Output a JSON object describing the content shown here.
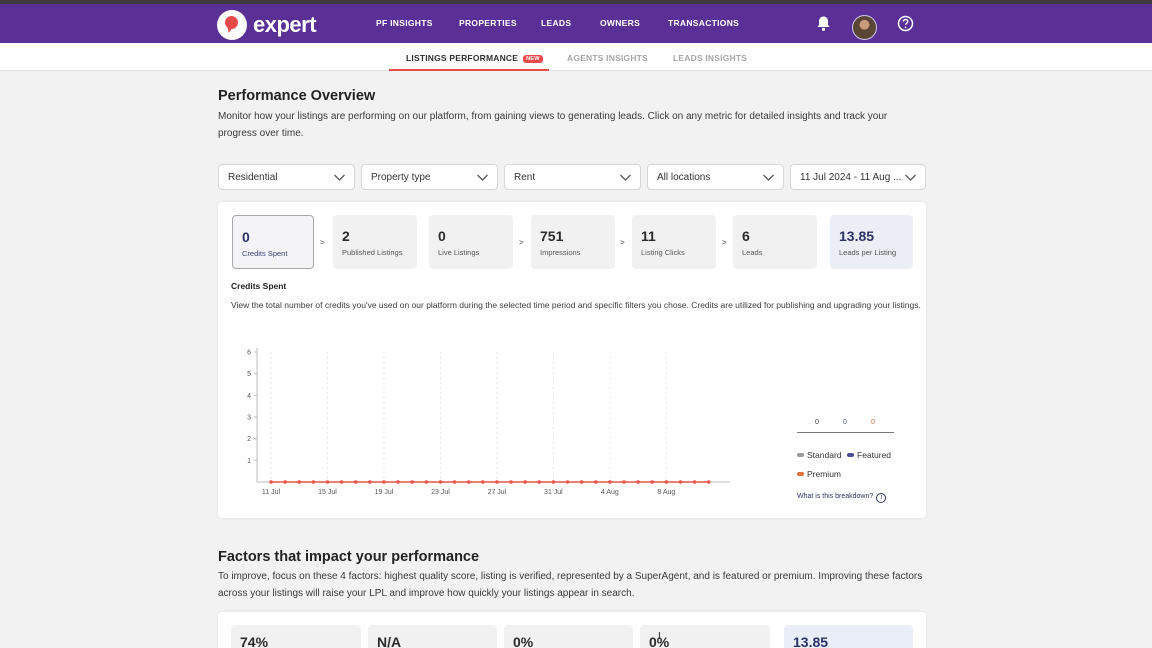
{
  "header": {
    "logo_text": "expert",
    "nav": [
      "PF INSIGHTS",
      "PROPERTIES",
      "LEADS",
      "OWNERS",
      "TRANSACTIONS"
    ],
    "icons": [
      "bell-icon",
      "avatar",
      "help-icon"
    ]
  },
  "subnav": {
    "tabs": [
      "LISTINGS PERFORMANCE",
      "AGENTS INSIGHTS",
      "LEADS INSIGHTS"
    ],
    "active_tab": "LISTINGS PERFORMANCE",
    "new_badge": "NEW"
  },
  "overview": {
    "title": "Performance Overview",
    "description": "Monitor how your listings are performing on our platform, from gaining views to generating leads. Click on any metric for detailed insights and track your progress over time."
  },
  "filters": [
    "Residential",
    "Property type",
    "Rent",
    "All locations",
    "11 Jul 2024 - 11 Aug ..."
  ],
  "metrics": [
    {
      "value": "0",
      "label": "Credits Spent"
    },
    {
      "value": "2",
      "label": "Published Listings"
    },
    {
      "value": "0",
      "label": "Live Listings"
    },
    {
      "value": "751",
      "label": "Impressions"
    },
    {
      "value": "11",
      "label": "Listing Clicks"
    },
    {
      "value": "6",
      "label": "Leads"
    },
    {
      "value": "13.85",
      "label": "Leads per Listing"
    }
  ],
  "metric_arrow": ">",
  "credits": {
    "title": "Credits Spent",
    "description": "View the total number of credits you've used on our platform during the selected time period and specific filters you chose. Credits are utilized for publishing and upgrading your listings."
  },
  "chart_data": {
    "type": "line",
    "x_tick_labels": [
      "11 Jul",
      "15 Jul",
      "19 Jul",
      "23 Jul",
      "27 Jul",
      "31 Jul",
      "4 Aug",
      "8 Aug"
    ],
    "y_tick_labels": [
      "1",
      "2",
      "3",
      "4",
      "5",
      "6"
    ],
    "ylim": [
      0,
      6
    ],
    "grid": "vertical dashed",
    "series": [
      {
        "color": "#e8554a",
        "x": [
          "11 Jul",
          "12 Jul",
          "13 Jul",
          "14 Jul",
          "15 Jul",
          "16 Jul",
          "17 Jul",
          "18 Jul",
          "19 Jul",
          "20 Jul",
          "21 Jul",
          "22 Jul",
          "23 Jul",
          "24 Jul",
          "25 Jul",
          "26 Jul",
          "27 Jul",
          "28 Jul",
          "29 Jul",
          "30 Jul",
          "31 Jul",
          "1 Aug",
          "2 Aug",
          "3 Aug",
          "4 Aug",
          "5 Aug",
          "6 Aug",
          "7 Aug",
          "8 Aug",
          "9 Aug",
          "10 Aug",
          "11 Aug"
        ],
        "values": [
          0,
          0,
          0,
          0,
          0,
          0,
          0,
          0,
          0,
          0,
          0,
          0,
          0,
          0,
          0,
          0,
          0,
          0,
          0,
          0,
          0,
          0,
          0,
          0,
          0,
          0,
          0,
          0,
          0,
          0,
          0,
          0
        ]
      }
    ],
    "legend": [
      {
        "name": "Standard",
        "value": "0",
        "color": "#9a9a9a"
      },
      {
        "name": "Featured",
        "value": "0",
        "color": "#4a4f9a"
      },
      {
        "name": "Premium",
        "value": "0",
        "color": "#e0703a"
      }
    ],
    "legend_position": "right"
  },
  "breakdown_link": "What is this breakdown?",
  "factors": {
    "title": "Factors that impact your performance",
    "description": "To improve, focus on these 4 factors: highest quality score, listing is verified, represented by a SuperAgent, and is featured or premium. Improving these factors across your listings will raise your LPL and improve how quickly your listings appear in search.",
    "values": [
      "74%",
      "N/A",
      "0%",
      "0%",
      "13.85"
    ]
  }
}
